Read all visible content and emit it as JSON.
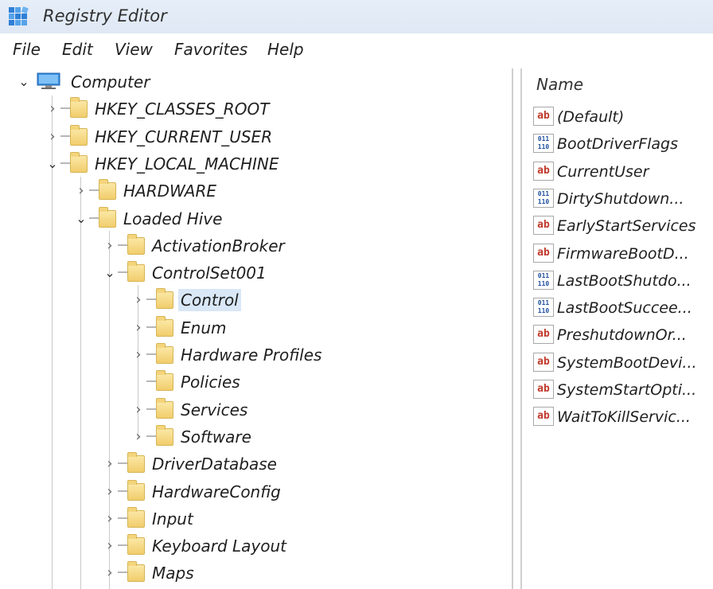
{
  "window": {
    "title": "Registry Editor",
    "icon": "registry-editor-icon"
  },
  "menu": [
    "File",
    "Edit",
    "View",
    "Favorites",
    "Help"
  ],
  "tree": [
    {
      "label": "Computer",
      "depth": 0,
      "state": "expanded",
      "icon": "computer-icon"
    },
    {
      "label": "HKEY_CLASSES_ROOT",
      "depth": 1,
      "state": "collapsed",
      "icon": "folder-icon"
    },
    {
      "label": "HKEY_CURRENT_USER",
      "depth": 1,
      "state": "collapsed",
      "icon": "folder-icon"
    },
    {
      "label": "HKEY_LOCAL_MACHINE",
      "depth": 1,
      "state": "expanded",
      "icon": "folder-icon"
    },
    {
      "label": "HARDWARE",
      "depth": 2,
      "state": "collapsed",
      "icon": "folder-icon"
    },
    {
      "label": "Loaded Hive",
      "depth": 2,
      "state": "expanded",
      "icon": "folder-icon"
    },
    {
      "label": "ActivationBroker",
      "depth": 3,
      "state": "collapsed",
      "icon": "folder-icon"
    },
    {
      "label": "ControlSet001",
      "depth": 3,
      "state": "expanded",
      "icon": "folder-icon"
    },
    {
      "label": "Control",
      "depth": 4,
      "state": "collapsed",
      "icon": "folder-icon",
      "selected": true
    },
    {
      "label": "Enum",
      "depth": 4,
      "state": "collapsed",
      "icon": "folder-icon"
    },
    {
      "label": "Hardware Profiles",
      "depth": 4,
      "state": "collapsed",
      "icon": "folder-icon"
    },
    {
      "label": "Policies",
      "depth": 4,
      "state": "leaf",
      "icon": "folder-icon"
    },
    {
      "label": "Services",
      "depth": 4,
      "state": "collapsed",
      "icon": "folder-icon"
    },
    {
      "label": "Software",
      "depth": 4,
      "state": "collapsed",
      "icon": "folder-icon"
    },
    {
      "label": "DriverDatabase",
      "depth": 3,
      "state": "collapsed",
      "icon": "folder-icon"
    },
    {
      "label": "HardwareConfig",
      "depth": 3,
      "state": "collapsed",
      "icon": "folder-icon"
    },
    {
      "label": "Input",
      "depth": 3,
      "state": "collapsed",
      "icon": "folder-icon"
    },
    {
      "label": "Keyboard Layout",
      "depth": 3,
      "state": "collapsed",
      "icon": "folder-icon"
    },
    {
      "label": "Maps",
      "depth": 3,
      "state": "collapsed",
      "icon": "folder-icon"
    }
  ],
  "values_pane": {
    "column_name": "Name",
    "items": [
      {
        "name": "(Default)",
        "type": "string"
      },
      {
        "name": "BootDriverFlags",
        "type": "binary"
      },
      {
        "name": "CurrentUser",
        "type": "string"
      },
      {
        "name": "DirtyShutdown...",
        "type": "binary"
      },
      {
        "name": "EarlyStartServices",
        "type": "string"
      },
      {
        "name": "FirmwareBootD...",
        "type": "string"
      },
      {
        "name": "LastBootShutdo...",
        "type": "binary"
      },
      {
        "name": "LastBootSuccee...",
        "type": "binary"
      },
      {
        "name": "PreshutdownOr...",
        "type": "string"
      },
      {
        "name": "SystemBootDevi...",
        "type": "string"
      },
      {
        "name": "SystemStartOpti...",
        "type": "string"
      },
      {
        "name": "WaitToKillServic...",
        "type": "string"
      }
    ]
  },
  "icon_glyphs": {
    "string": "ab",
    "binary": [
      "011",
      "110"
    ],
    "expanded": "⌄",
    "collapsed": "›"
  },
  "colors": {
    "titlebar": "#e2ebf6",
    "selection": "#d9e7f7",
    "folder": "#f4d57c",
    "string_icon": "#c0392b",
    "binary_icon": "#1f4f9e"
  }
}
